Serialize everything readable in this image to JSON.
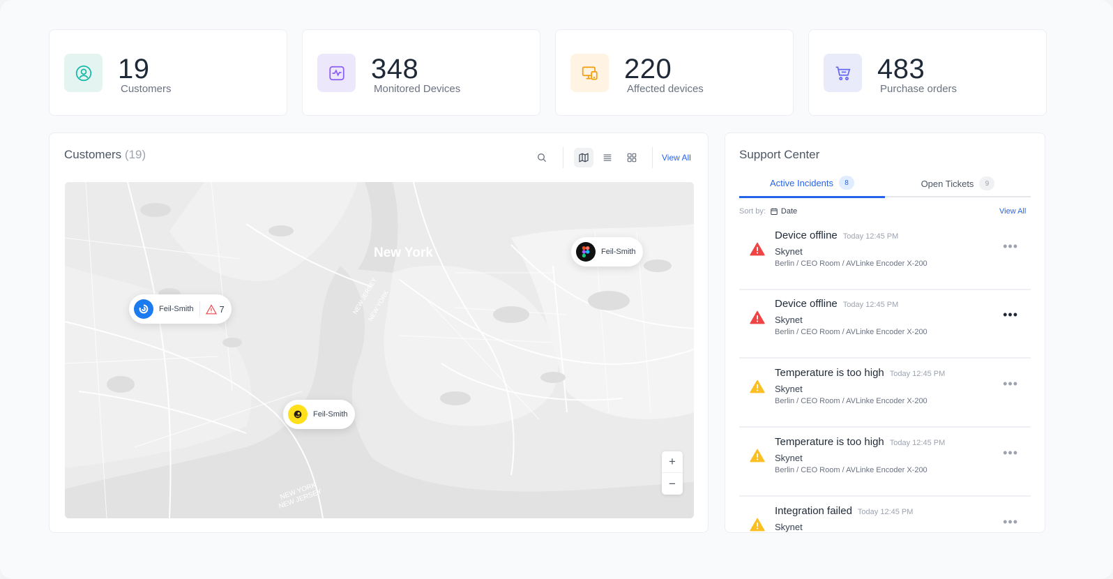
{
  "stats": [
    {
      "value": "19",
      "label": "Customers",
      "icon": "user-circle-icon",
      "bg": "#e3f4f1",
      "color": "#14b8a6"
    },
    {
      "value": "348",
      "label": "Monitored Devices",
      "icon": "monitor-pulse-icon",
      "bg": "#ede7fb",
      "color": "#8b5cf6"
    },
    {
      "value": "220",
      "label": "Affected devices",
      "icon": "devices-icon",
      "bg": "#fff3e3",
      "color": "#f59e0b"
    },
    {
      "value": "483",
      "label": "Purchase orders",
      "icon": "cart-icon",
      "bg": "#e9ebfb",
      "color": "#6366f1"
    }
  ],
  "customers": {
    "title": "Customers",
    "count": "(19)",
    "view_all": "View All",
    "map": {
      "labels": [
        "New York",
        "NEW JERSEY",
        "NEW YORK",
        "NEW YORK",
        "NEW JERSEY"
      ],
      "pins": [
        {
          "name": "Feil-Smith",
          "logo": "figma-logo",
          "alerts": null
        },
        {
          "name": "Feil-Smith",
          "logo": "blue-swirl-logo",
          "alerts": "7"
        },
        {
          "name": "Feil-Smith",
          "logo": "mailchimp-logo",
          "alerts": null
        }
      ],
      "zoom_in": "+",
      "zoom_out": "−"
    }
  },
  "support": {
    "title": "Support Center",
    "tabs": [
      {
        "label": "Active Incidents",
        "count": "8"
      },
      {
        "label": "Open Tickets",
        "count": "9"
      }
    ],
    "sort_label": "Sort by:",
    "sort_value": "Date",
    "view_all": "View All",
    "incidents": [
      {
        "title": "Device offline",
        "time": "Today 12:45 PM",
        "customer": "Skynet",
        "path": "Berlin / CEO Room / AVLinke Encoder X-200",
        "severity": "critical"
      },
      {
        "title": "Device offline",
        "time": "Today 12:45 PM",
        "customer": "Skynet",
        "path": "Berlin / CEO Room / AVLinke Encoder X-200",
        "severity": "critical"
      },
      {
        "title": "Temperature is too high",
        "time": "Today 12:45 PM",
        "customer": "Skynet",
        "path": "Berlin / CEO Room / AVLinke Encoder X-200",
        "severity": "warning"
      },
      {
        "title": "Temperature is too high",
        "time": "Today 12:45 PM",
        "customer": "Skynet",
        "path": "Berlin / CEO Room / AVLinke Encoder X-200",
        "severity": "warning"
      },
      {
        "title": "Integration failed",
        "time": "Today 12:45 PM",
        "customer": "Skynet",
        "path": "",
        "severity": "warning"
      }
    ],
    "colors": {
      "critical": "#ef4444",
      "warning": "#fbbf24",
      "accent": "#2563eb"
    }
  }
}
